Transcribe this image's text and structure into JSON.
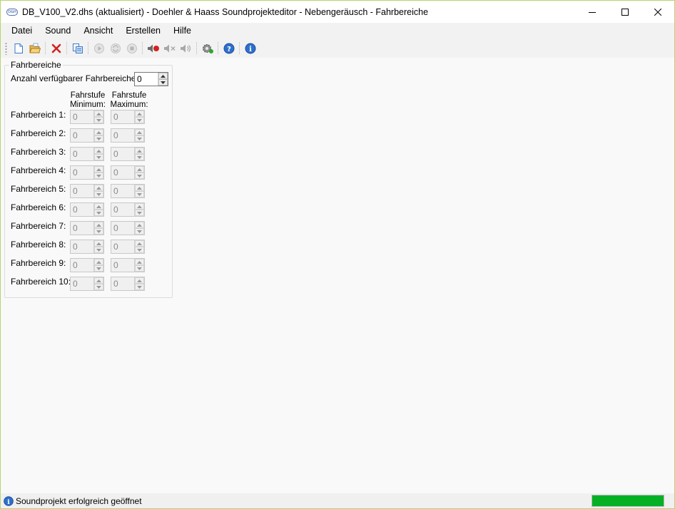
{
  "window": {
    "icon_text": "D&H",
    "title": "DB_V100_V2.dhs (aktualisiert) - Doehler & Haass Soundprojekteditor - Nebengeräusch - Fahrbereiche"
  },
  "menu": [
    "Datei",
    "Sound",
    "Ansicht",
    "Erstellen",
    "Hilfe"
  ],
  "toolbar": {
    "buttons": [
      "new-file-icon",
      "open-folder-icon",
      "delete-icon",
      "copy-icon",
      "play-icon",
      "loop-icon",
      "stop-icon",
      "speaker-red-icon",
      "speaker-mute-icon",
      "speaker-icon",
      "settings-gear-icon",
      "help-icon",
      "info-icon"
    ]
  },
  "group": {
    "title": "Fahrbereiche",
    "count_label": "Anzahl verfügbarer Fahrbereiche:",
    "count_value": "0",
    "col_min": [
      "Fahrstufe",
      "Minimum:"
    ],
    "col_max": [
      "Fahrstufe",
      "Maximum:"
    ],
    "rows": [
      {
        "label": "Fahrbereich 1:",
        "min": "0",
        "max": "0"
      },
      {
        "label": "Fahrbereich 2:",
        "min": "0",
        "max": "0"
      },
      {
        "label": "Fahrbereich 3:",
        "min": "0",
        "max": "0"
      },
      {
        "label": "Fahrbereich 4:",
        "min": "0",
        "max": "0"
      },
      {
        "label": "Fahrbereich 5:",
        "min": "0",
        "max": "0"
      },
      {
        "label": "Fahrbereich 6:",
        "min": "0",
        "max": "0"
      },
      {
        "label": "Fahrbereich 7:",
        "min": "0",
        "max": "0"
      },
      {
        "label": "Fahrbereich 8:",
        "min": "0",
        "max": "0"
      },
      {
        "label": "Fahrbereich 9:",
        "min": "0",
        "max": "0"
      },
      {
        "label": "Fahrbereich 10:",
        "min": "0",
        "max": "0"
      }
    ]
  },
  "status": {
    "text": "Soundprojekt erfolgreich geöffnet",
    "progress_fraction": 1.0,
    "accent": "#06b025"
  }
}
